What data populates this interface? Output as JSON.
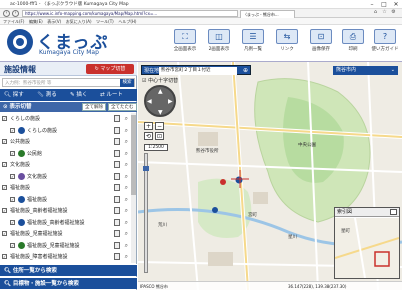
{
  "browser": {
    "title": "ac-1000-fff1 - 〈まっぷクラウド版 Kumagaya City Map",
    "url": "https://www.ic.info-mapping.com/kumagaya/Map/Map.html?cx=...",
    "tab": "〈まっぷ - 熊谷市...",
    "menu": [
      "ファイル(F)",
      "編集(E)",
      "表示(V)",
      "お気に入り(A)",
      "ツール(T)",
      "ヘルプ(H)"
    ]
  },
  "app": {
    "logo": "くまっぷ",
    "logo_sub": "Kumagaya City Map",
    "tools": [
      {
        "label": "全画面表示",
        "icon": "⛶"
      },
      {
        "label": "2画面表示",
        "icon": "◫"
      },
      {
        "label": "凡例一覧",
        "icon": "☰"
      },
      {
        "label": "リンク",
        "icon": "⇆"
      },
      {
        "label": "画像保存",
        "icon": "⊡"
      },
      {
        "label": "印刷",
        "icon": "⎙"
      },
      {
        "label": "使い方ガイド",
        "icon": "?"
      }
    ]
  },
  "sidebar": {
    "title": "施設情報",
    "map_button": "マップ切替",
    "search_placeholder": "入力例：熊谷市役所 等",
    "search_go": "検索",
    "actions": [
      "探す",
      "測る",
      "描く",
      "ルート"
    ],
    "section": "表示切替",
    "btn_all_off": "全て解除",
    "btn_close": "全てたたむ",
    "tree": [
      {
        "label": "くらしの施設",
        "checked": true,
        "level": 0
      },
      {
        "label": "くらしの施設",
        "checked": true,
        "level": 1,
        "color": "#1b4f9b"
      },
      {
        "label": "公共施設",
        "checked": true,
        "level": 0
      },
      {
        "label": "公民館",
        "checked": true,
        "level": 1,
        "color": "#2a7a2a"
      },
      {
        "label": "文化施設",
        "checked": true,
        "level": 0
      },
      {
        "label": "文化施設",
        "checked": true,
        "level": 1,
        "color": "#6a4fa0"
      },
      {
        "label": "福祉施設",
        "checked": true,
        "level": 0
      },
      {
        "label": "福祉施設",
        "checked": true,
        "level": 1,
        "color": "#1b4f9b"
      },
      {
        "label": "福祉施設_高齢者福祉施設",
        "checked": true,
        "level": 0
      },
      {
        "label": "福祉施設_高齢者福祉施設",
        "checked": true,
        "level": 1,
        "color": "#1b4f9b"
      },
      {
        "label": "福祉施設_児童福祉施設",
        "checked": true,
        "level": 0
      },
      {
        "label": "福祉施設_児童福祉施設",
        "checked": true,
        "level": 1,
        "color": "#2a7a2a"
      },
      {
        "label": "福祉施設_障害者福祉施設",
        "checked": true,
        "level": 0
      }
    ],
    "bottom": [
      "住所一覧から検索",
      "目標物・施設一覧から検索"
    ]
  },
  "map": {
    "location_label": "現在地",
    "location_value": "熊谷市宮町２丁目１付近",
    "area_select": "熊谷市内",
    "layer_check": "中心十字切替",
    "scale": "1:2500",
    "zoom_plus": "+",
    "zoom_minus": "−",
    "overview_title": "索引図",
    "footer_left": "IPASCO  熊谷市",
    "footer_right": "36.147(228), 139.38(237.30)",
    "labels": [
      "熊谷市役所",
      "荒川",
      "星川",
      "宮町",
      "中央公園"
    ],
    "overview_label": "星町"
  }
}
